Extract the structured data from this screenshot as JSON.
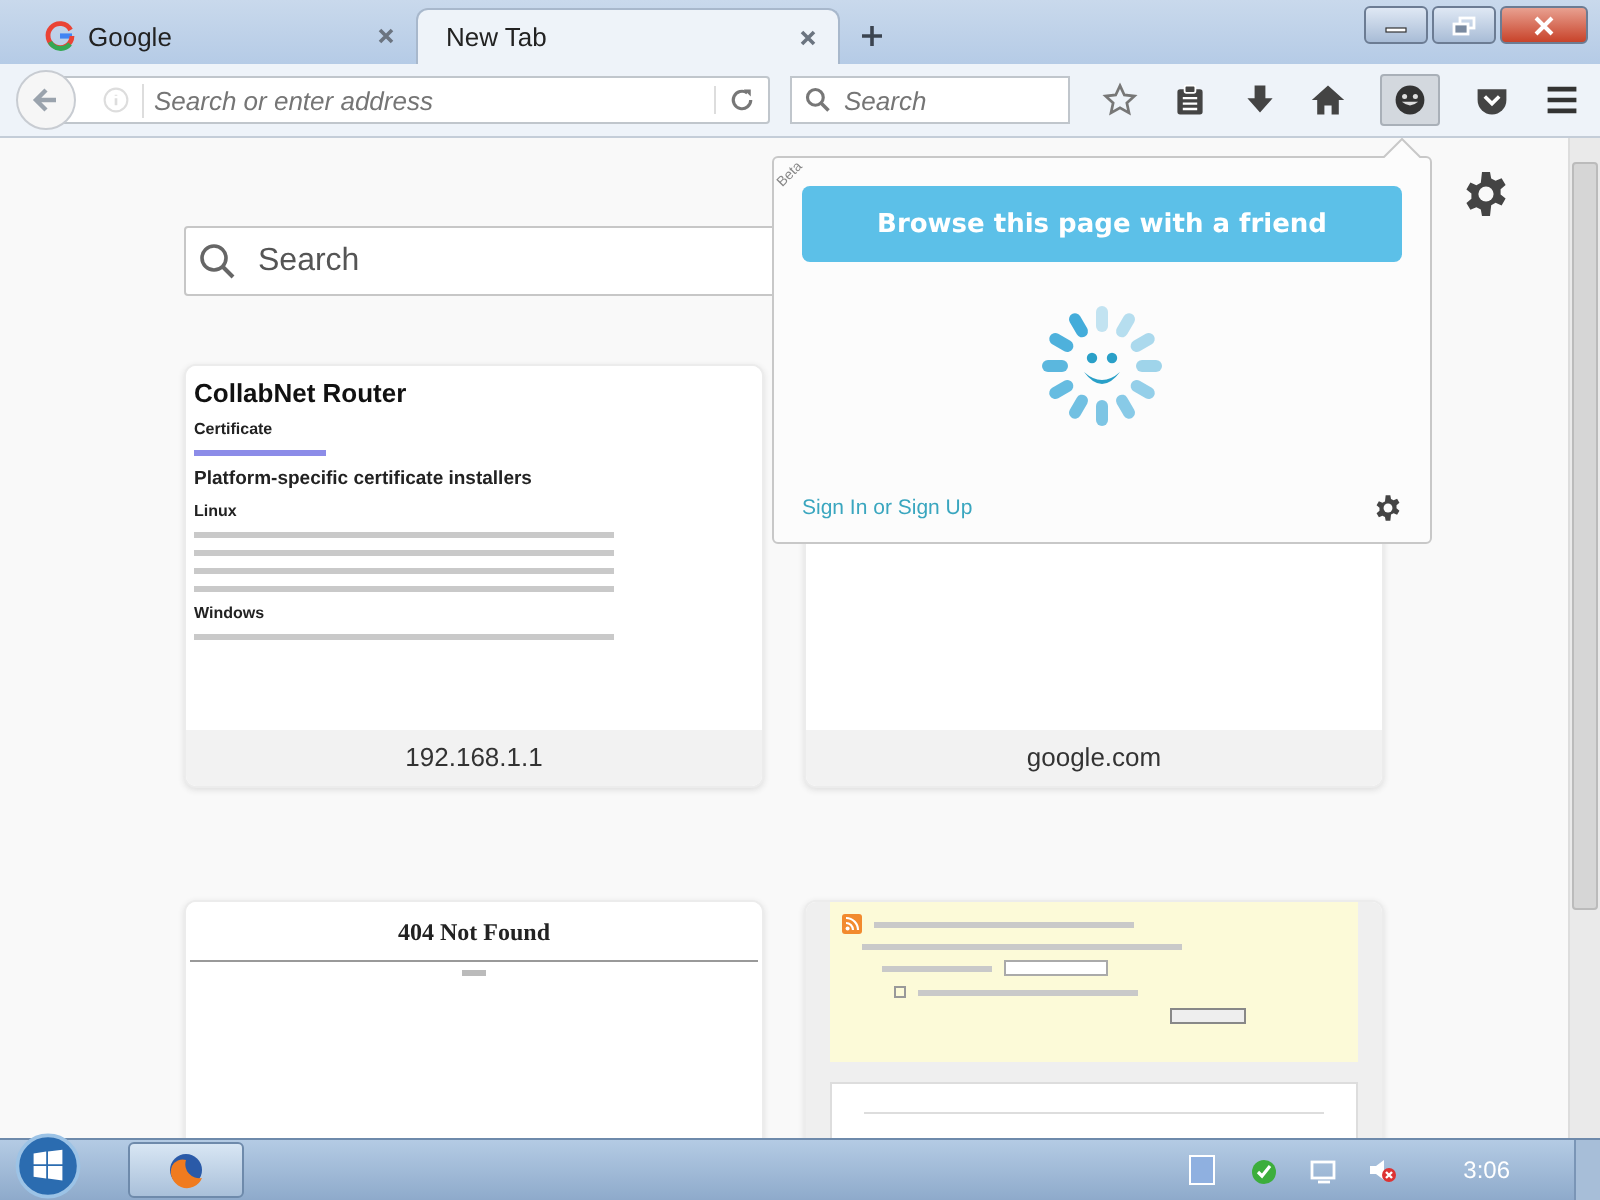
{
  "tabs": [
    {
      "label": "Google",
      "selected": false,
      "kind": "favicon"
    },
    {
      "label": "New Tab",
      "selected": true,
      "kind": "plain"
    }
  ],
  "toolbar": {
    "address": {
      "placeholder": "Search or enter address"
    },
    "search": {
      "placeholder": "Search"
    },
    "hello_pressed": true
  },
  "newtab": {
    "search": {
      "placeholder": "Search"
    },
    "tiles": [
      {
        "kind": "document",
        "label": "192.168.1.1",
        "blocks": [
          {
            "kind": "title",
            "text": "CollabNet Router"
          },
          {
            "kind": "heading",
            "text": "Certificate"
          },
          {
            "kind": "link"
          },
          {
            "kind": "subtitle",
            "text": "Platform-specific certificate installers"
          },
          {
            "kind": "heading",
            "text": "Linux"
          },
          {
            "kind": "blur"
          },
          {
            "kind": "blur"
          },
          {
            "kind": "blur"
          },
          {
            "kind": "blur"
          },
          {
            "kind": "heading",
            "text": "Windows"
          },
          {
            "kind": "blur"
          }
        ]
      },
      {
        "kind": "blank",
        "label": "google.com"
      },
      {
        "kind": "notfound",
        "title": "404 Not Found"
      },
      {
        "kind": "feed",
        "checkbox_checked": false
      }
    ]
  },
  "popup": {
    "badge": "Beta",
    "button": "Browse this page with a friend",
    "link": "Sign In or Sign Up"
  },
  "taskbar": {
    "time": "3:06"
  }
}
